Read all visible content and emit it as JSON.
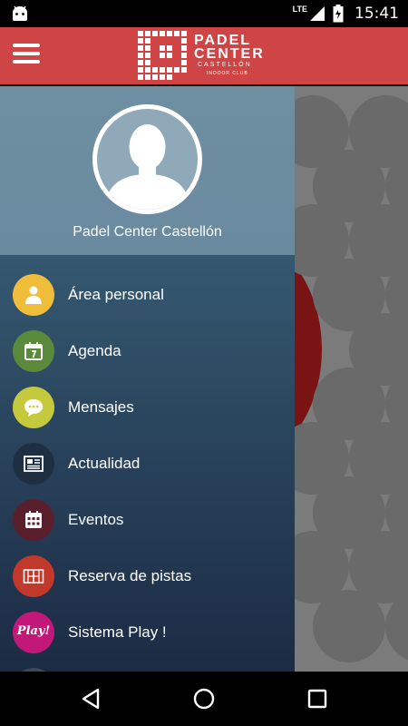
{
  "status_bar": {
    "network": "LTE",
    "time": "15:41"
  },
  "app_bar": {
    "logo_line1": "PADEL",
    "logo_line2": "CENTER",
    "logo_line3": "CASTELLÓN",
    "logo_line4": "INDOOR CLUB"
  },
  "drawer": {
    "profile_name": "Padel Center Castellón",
    "items": [
      {
        "label": "Área personal",
        "icon": "person-icon",
        "color": "#f0bd3b"
      },
      {
        "label": "Agenda",
        "icon": "calendar-icon",
        "color": "#5a8a3c"
      },
      {
        "label": "Mensajes",
        "icon": "chat-bubble-icon",
        "color": "#c5c93e"
      },
      {
        "label": "Actualidad",
        "icon": "newspaper-icon",
        "color": "#1f2f42"
      },
      {
        "label": "Eventos",
        "icon": "calendar-grid-icon",
        "color": "#5a1f2c"
      },
      {
        "label": "Reserva de pistas",
        "icon": "court-icon",
        "color": "#c0392b"
      },
      {
        "label": "Sistema Play !",
        "icon": "play-badge-icon",
        "icon_text": "Play!",
        "color": "#c2187a"
      }
    ]
  },
  "colors": {
    "app_bar": "#cf4444",
    "drawer_header": "#6e8ea1",
    "drawer_body": "#2b4760"
  }
}
